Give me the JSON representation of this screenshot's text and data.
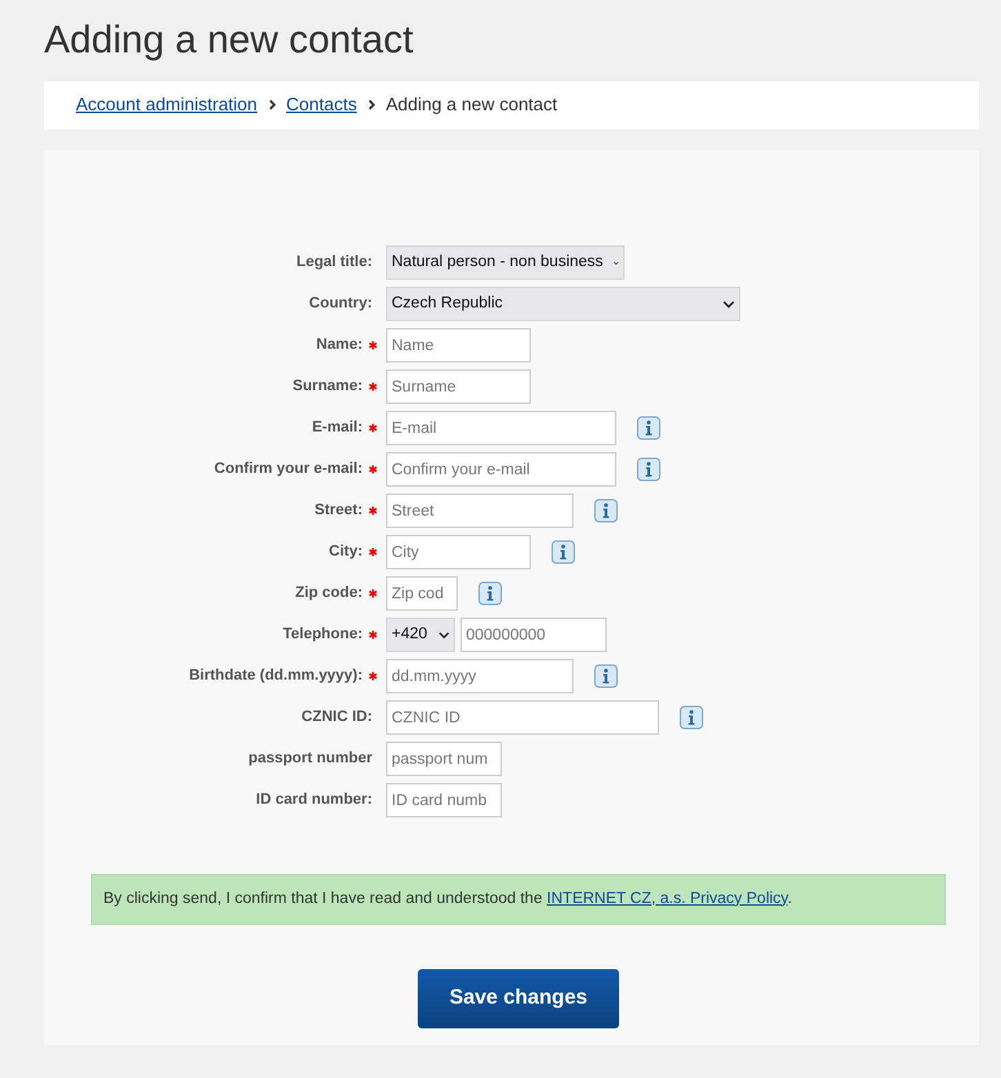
{
  "title": "Adding a new contact",
  "breadcrumb": [
    {
      "label": "Account administration",
      "kind": "link"
    },
    {
      "label": "Contacts",
      "kind": "link"
    },
    {
      "label": "Adding a new contact",
      "kind": "current"
    }
  ],
  "fields": [
    {
      "label": "Legal title:",
      "kind": "select",
      "value": "Natural person - non business",
      "required": false,
      "info": false
    },
    {
      "label": "Country:",
      "kind": "select",
      "value": "Czech Republic",
      "required": false,
      "info": false
    },
    {
      "label": "Name:",
      "kind": "text",
      "placeholder": "Name",
      "required": true,
      "info": false
    },
    {
      "label": "Surname:",
      "kind": "text",
      "placeholder": "Surname",
      "required": true,
      "info": false
    },
    {
      "label": "E-mail:",
      "kind": "text",
      "placeholder": "E-mail",
      "required": true,
      "info": true
    },
    {
      "label": "Confirm your e-mail:",
      "kind": "text",
      "placeholder": "Confirm your e-mail",
      "required": true,
      "info": true
    },
    {
      "label": "Street:",
      "kind": "text",
      "placeholder": "Street",
      "required": true,
      "info": true
    },
    {
      "label": "City:",
      "kind": "text",
      "placeholder": "City",
      "required": true,
      "info": true
    },
    {
      "label": "Zip code:",
      "kind": "text",
      "placeholder": "Zip cod",
      "required": true,
      "info": true
    },
    {
      "label": "Telephone:",
      "kind": "phone",
      "value": "+420",
      "placeholder": "000000000",
      "required": true,
      "info": false
    },
    {
      "label": "Birthdate (dd.mm.yyyy):",
      "kind": "text",
      "placeholder": "dd.mm.yyyy",
      "required": true,
      "info": true
    },
    {
      "label": "CZNIC ID:",
      "kind": "text",
      "placeholder": "CZNIC ID",
      "required": false,
      "info": true
    },
    {
      "label": "passport number",
      "kind": "text",
      "placeholder": "passport num",
      "required": false,
      "info": false
    },
    {
      "label": "ID card number:",
      "kind": "text",
      "placeholder": "ID card numb",
      "required": false,
      "info": false
    }
  ],
  "notice": {
    "text": "By clicking send, I confirm that I have read and understood the",
    "link": "INTERNET CZ, a.s. Privacy Policy",
    "end": "."
  },
  "submit": "Save changes"
}
